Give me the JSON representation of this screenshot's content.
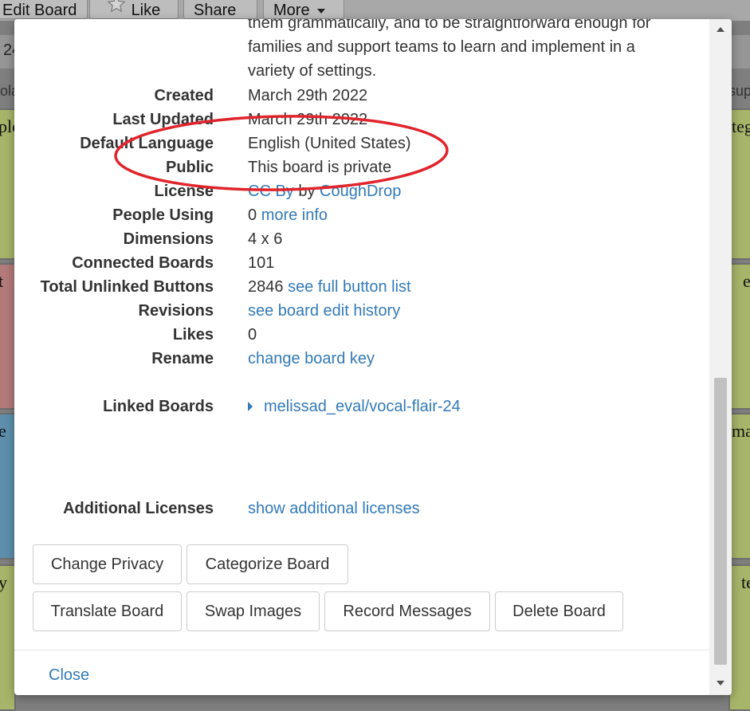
{
  "background": {
    "toolbar": {
      "edit_board": "Edit Board",
      "like": "Like",
      "share": "Share",
      "more": "More"
    },
    "row2_text": "24",
    "side_left": "ola",
    "side_right": "sup",
    "cells": [
      {
        "label": "ple"
      },
      {
        "label": "t"
      },
      {
        "label": "e"
      },
      {
        "label": "y"
      },
      {
        "label": "teg"
      },
      {
        "label": "e"
      },
      {
        "label": "ma"
      },
      {
        "label": "te"
      }
    ]
  },
  "details": {
    "description": "them grammatically, and to be straightforward enough for families and support teams to learn and implement in a variety of settings.",
    "created": {
      "label": "Created",
      "value": "March 29th 2022"
    },
    "last_updated": {
      "label": "Last Updated",
      "value": "March 29th 2022"
    },
    "default_language": {
      "label": "Default Language",
      "value": "English (United States)"
    },
    "public": {
      "label": "Public",
      "value": "This board is private"
    },
    "license": {
      "label": "License",
      "link": "CC By",
      "by": "by",
      "author": "CoughDrop"
    },
    "people_using": {
      "label": "People Using",
      "value": "0",
      "link": "more info"
    },
    "dimensions": {
      "label": "Dimensions",
      "value": "4 x 6"
    },
    "connected_boards": {
      "label": "Connected Boards",
      "value": "101"
    },
    "total_unlinked": {
      "label": "Total Unlinked Buttons",
      "value": "2846",
      "link": "see full button list"
    },
    "revisions": {
      "label": "Revisions",
      "link": "see board edit history"
    },
    "likes": {
      "label": "Likes",
      "value": "0"
    },
    "rename": {
      "label": "Rename",
      "link": "change board key"
    },
    "linked_boards": {
      "label": "Linked Boards",
      "items": [
        "melissad_eval/vocal-flair-24"
      ]
    },
    "additional_licenses": {
      "label": "Additional Licenses",
      "link": "show additional licenses"
    }
  },
  "buttons": {
    "change_privacy": "Change Privacy",
    "categorize_board": "Categorize Board",
    "translate_board": "Translate Board",
    "swap_images": "Swap Images",
    "record_messages": "Record Messages",
    "delete_board": "Delete Board"
  },
  "footer": {
    "close": "Close"
  },
  "colors": {
    "link": "#337ab7",
    "annotation": "#e0242c",
    "overlay": "#7f7f7f"
  },
  "icons": [
    "star-icon",
    "caret-down-icon",
    "caret-right-icon",
    "scroll-up-icon",
    "scroll-down-icon"
  ]
}
